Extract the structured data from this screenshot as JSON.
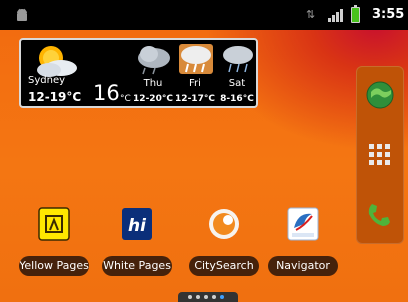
{
  "status_bar": {
    "time": "3:55 pm",
    "notification_icon": "android-icon",
    "sync_icon": "data-arrows-icon",
    "signal_icon": "signal-bars-icon",
    "battery_icon": "battery-charging-icon"
  },
  "weather_widget": {
    "current": {
      "city": "Sydney",
      "range": "12-19°C",
      "temp": "16",
      "unit": "°C",
      "icon": "partly-sunny-icon"
    },
    "forecast": [
      {
        "day": "Thu",
        "range": "12-20°C",
        "icon": "cloudy-icon"
      },
      {
        "day": "Fri",
        "range": "12-17°C",
        "icon": "cloudy-rain-icon"
      },
      {
        "day": "Sat",
        "range": "8-16°C",
        "icon": "rain-icon"
      }
    ]
  },
  "dock": {
    "items": [
      {
        "name": "browser",
        "icon": "globe-icon"
      },
      {
        "name": "all-apps",
        "icon": "app-grid-icon"
      },
      {
        "name": "phone",
        "icon": "phone-icon"
      }
    ]
  },
  "apps": [
    {
      "label": "Yellow Pages",
      "icon": "yellow-pages-icon"
    },
    {
      "label": "White Pages",
      "icon": "white-pages-icon"
    },
    {
      "label": "CitySearch",
      "icon": "citysearch-icon"
    },
    {
      "label": "Navigator",
      "icon": "navigator-icon"
    }
  ],
  "pager": {
    "count": 5,
    "active_index": 4
  },
  "colors": {
    "wallpaper": "#f47612",
    "status_bar": "#000000",
    "dock": "#bf5307",
    "label_bg": "#2a140a"
  }
}
